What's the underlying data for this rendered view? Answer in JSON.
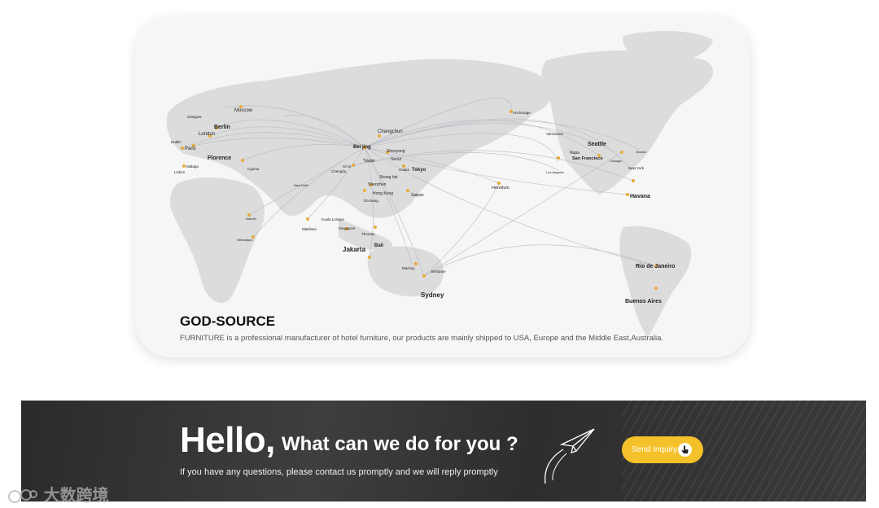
{
  "map": {
    "brand": "GOD-SOURCE",
    "description": "FURNITURE is a professional manufacturer of hotel furniture, our products are mainly shipped to USA, Europe and the Middle East,Australia.",
    "cities": {
      "moscow": "Moscow",
      "glasgow": "Glasgow",
      "berlin": "Berlin",
      "london": "London",
      "dublin": "Dublin",
      "paris": "Paris",
      "florence": "Florence",
      "malaga": "Malaga",
      "lisbon": "Lisbon",
      "cyprus": "Cyprus",
      "changchun": "Changchun",
      "beijing": "Bei jing",
      "shenyang": "Shenyang",
      "tianjin": "Tianjin",
      "seoul": "Seoul",
      "osaka": "Osaka",
      "tokyo": "Tokyo",
      "xian": "Xi'An",
      "chengdu": "Chengdu",
      "shanghai": "Shang hai",
      "shenzhen": "Shenzhen",
      "hongkong": "Hong Kong",
      "saipan": "Saipan",
      "danang": "Da Nang",
      "kualalumpur": "Kuala Lumpur",
      "singapore": "Singapore",
      "maldives": "Maldives",
      "jakarta": "Jakarta",
      "bali": "Bali",
      "sydney": "Sydney",
      "brisbane": "Brisbane",
      "mackay": "Mackay",
      "honolulu": "Honolulu",
      "anchorage": "Anchorage",
      "vancouver": "Vancouver",
      "seattle": "Seattle",
      "napa": "Napa",
      "sanfrancisco": "San Francisco",
      "losangeles": "Los Angeles",
      "newyork": "New York",
      "boston": "Boston",
      "chicago": "Chicago",
      "havana": "Havana",
      "riodejaneiro": "Rio de Janeiro",
      "buenosaires": "Buenos Aires",
      "nairobi": "Nairobi",
      "kilimanjaro": "Kilimanjaro",
      "newdelhi": "New Delhi",
      "thorvau": "Thorvau"
    }
  },
  "banner": {
    "hello": "Hello,",
    "subtitle": "What can we do for you ?",
    "text": "If you have any questions, please contact us promptly and we will reply promptly",
    "button_label": "Send Inquiry"
  },
  "watermark": "大数跨境",
  "colors": {
    "accent": "#f5c12a",
    "banner_bg": "#333333",
    "route": "#b8b8c4",
    "dot": "#e8a93a"
  }
}
